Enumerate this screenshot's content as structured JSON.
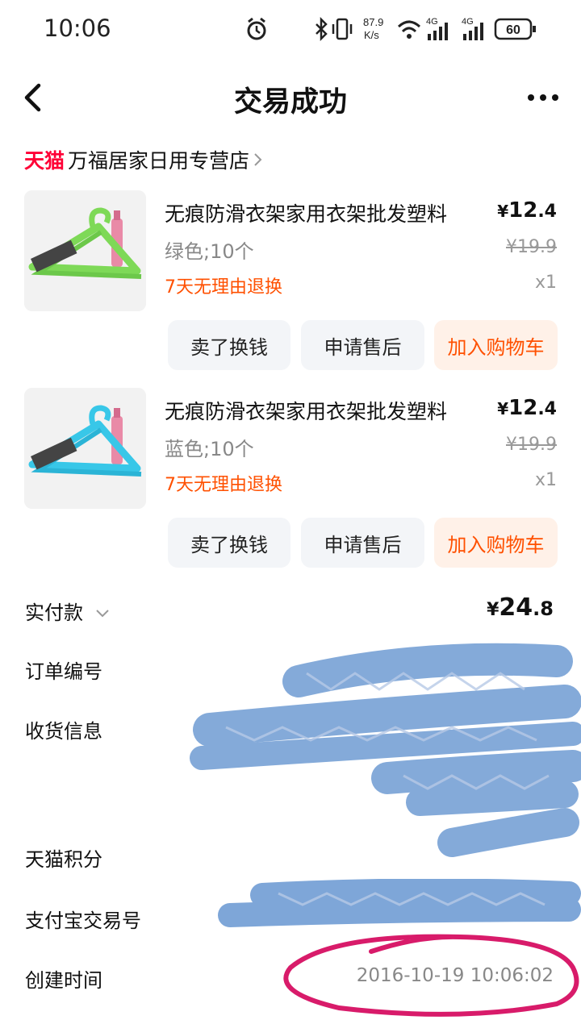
{
  "status_bar": {
    "time": "10:06",
    "net_speed_value": "87.9",
    "net_speed_unit": "K/s",
    "signal_1": "4G",
    "signal_2": "4G",
    "battery": "60",
    "icons": [
      "alarm-icon",
      "bluetooth-icon",
      "vibrate-icon",
      "wifi-icon",
      "signal-icon",
      "battery-icon"
    ]
  },
  "header": {
    "title": "交易成功"
  },
  "store": {
    "brand": "天猫",
    "name": "万福居家日用专营店"
  },
  "products": [
    {
      "title": "无痕防滑衣架家用衣架批发塑料",
      "spec": "绿色;10个",
      "badge": "7天无理由退换",
      "price_symbol": "¥",
      "price_int": "12",
      "price_dec": ".4",
      "original_price": "¥19.9",
      "qty": "x1",
      "color": "#7ed957",
      "actions": {
        "sell": "卖了换钱",
        "after_sale": "申请售后",
        "add_cart": "加入购物车"
      }
    },
    {
      "title": "无痕防滑衣架家用衣架批发塑料",
      "spec": "蓝色;10个",
      "badge": "7天无理由退换",
      "price_symbol": "¥",
      "price_int": "12",
      "price_dec": ".4",
      "original_price": "¥19.9",
      "qty": "x1",
      "color": "#38c7e8",
      "actions": {
        "sell": "卖了换钱",
        "after_sale": "申请售后",
        "add_cart": "加入购物车"
      }
    }
  ],
  "summary": {
    "paid_label": "实付款",
    "paid_symbol": "¥",
    "paid_int": "24",
    "paid_dec": ".8",
    "order_no_label": "订单编号",
    "address_label": "收货信息",
    "points_label": "天猫积分",
    "alipay_label": "支付宝交易号",
    "created_label": "创建时间",
    "created_value": "2016-10-19 10:06:02"
  },
  "colors": {
    "accent": "#ff5000",
    "tmall_red": "#ff0036",
    "redaction_blue": "#7ea6d8",
    "annotation_pink": "#d81b6a"
  }
}
